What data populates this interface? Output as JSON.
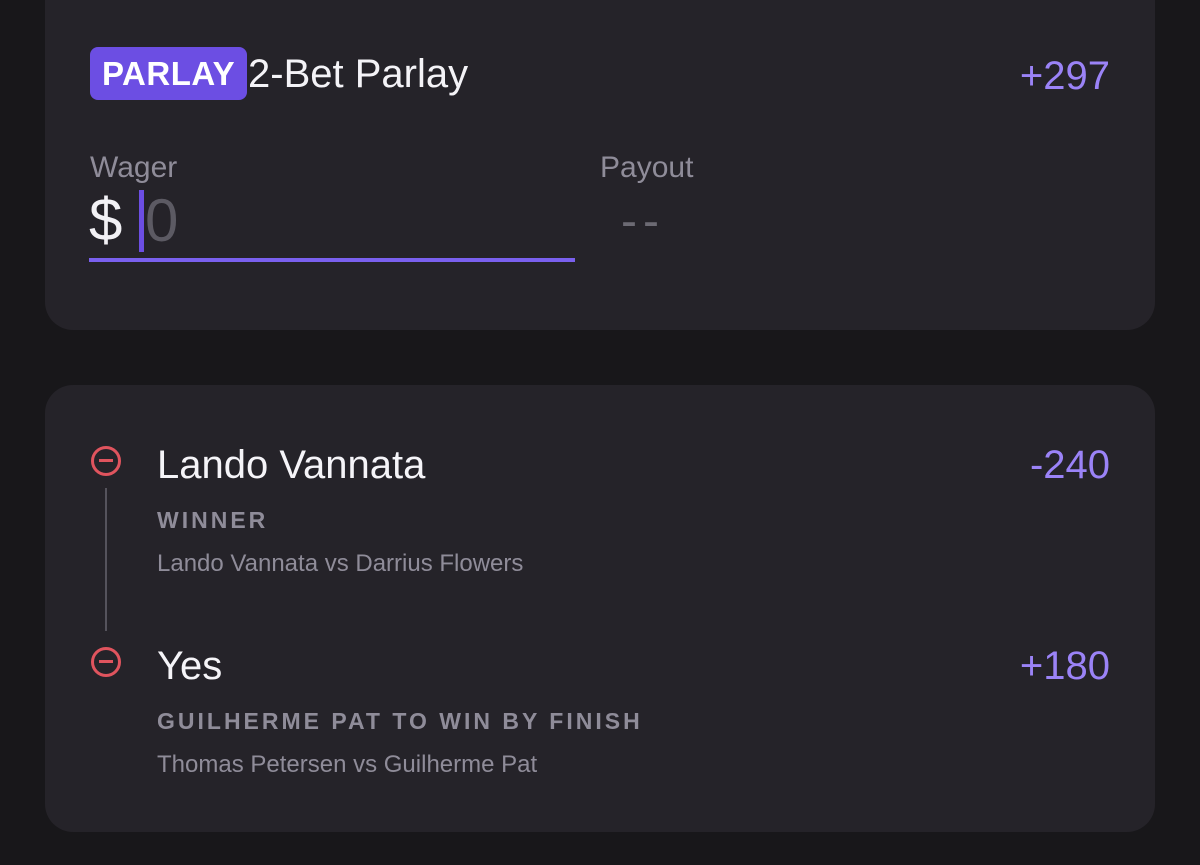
{
  "parlay": {
    "badge": "PARLAY",
    "title": "2-Bet Parlay",
    "odds": "+297",
    "wager_label": "Wager",
    "currency": "$",
    "wager_placeholder": "0",
    "payout_label": "Payout",
    "payout_value": "--"
  },
  "legs": [
    {
      "selection": "Lando Vannata",
      "odds": "-240",
      "market": "WINNER",
      "event": "Lando Vannata vs Darrius Flowers",
      "remove_icon": "minus-circle-icon"
    },
    {
      "selection": "Yes",
      "odds": "+180",
      "market": "GUILHERME PAT TO WIN BY FINISH",
      "event": "Thomas Petersen vs Guilherme Pat",
      "remove_icon": "minus-circle-icon"
    }
  ],
  "colors": {
    "accent": "#7a60ee",
    "odds": "#9b83f7",
    "remove": "#e0545e",
    "card": "#252329",
    "background": "#18171a"
  }
}
